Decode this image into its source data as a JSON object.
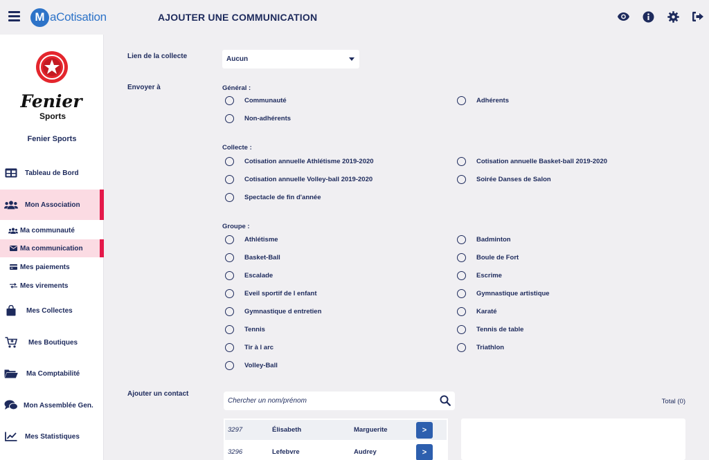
{
  "header": {
    "logo_letter": "M",
    "logo_text": "aCotisation",
    "page_title": "AJOUTER UNE COMMUNICATION",
    "icons": [
      "eye-icon",
      "info-icon",
      "gear-icon",
      "logout-icon"
    ]
  },
  "sidebar": {
    "club_name": "Fenier Sports",
    "club_logo_text": "Fenier",
    "club_logo_subtext": "Sports",
    "items": [
      {
        "label": "Tableau de Bord",
        "icon": "dashboard-icon"
      },
      {
        "label": "Mon Association",
        "icon": "users-icon",
        "active": true
      },
      {
        "label": "Ma communauté",
        "icon": "users-small-icon"
      },
      {
        "label": "Ma communication",
        "icon": "envelope-icon",
        "active": true
      },
      {
        "label": "Mes paiements",
        "icon": "card-icon"
      },
      {
        "label": "Mes virements",
        "icon": "transfer-icon"
      },
      {
        "label": "Mes Collectes",
        "icon": "bag-icon"
      },
      {
        "label": "Mes Boutiques",
        "icon": "cart-icon"
      },
      {
        "label": "Ma Comptabilité",
        "icon": "folder-icon"
      },
      {
        "label": "Mon Assemblée Gen.",
        "icon": "comments-icon"
      },
      {
        "label": "Mes Statistiques",
        "icon": "chart-icon"
      }
    ]
  },
  "form": {
    "collecte_label": "Lien de la collecte",
    "collecte_value": "Aucun",
    "envoyer_label": "Envoyer à",
    "general_title": "Général :",
    "general": [
      "Communauté",
      "Adhérents",
      "Non-adhérents"
    ],
    "collecte_title": "Collecte :",
    "collectes": [
      "Cotisation annuelle Athlétisme 2019-2020",
      "Cotisation annuelle Basket-ball 2019-2020",
      "Cotisation annuelle Volley-ball 2019-2020",
      "Soirée Danses de Salon",
      "Spectacle de fin d'année"
    ],
    "groupe_title": "Groupe :",
    "groupes": [
      "Athlétisme",
      "Badminton",
      "Basket-Ball",
      "Boule de Fort",
      "Escalade",
      "Escrime",
      "Eveil sportif de l enfant",
      "Gymnastique artistique",
      "Gymnastique d entretien",
      "Karaté",
      "Tennis",
      "Tennis de table",
      "Tir à l arc",
      "Triathlon",
      "Volley-Ball"
    ],
    "contact_label": "Ajouter un contact",
    "search_placeholder": "Chercher un nom/prénom",
    "total": "Total (0)"
  },
  "contacts": [
    {
      "id": "3297",
      "first": "Élisabeth",
      "last": "Marguerite",
      "btn": ">"
    },
    {
      "id": "3296",
      "first": "Lefebvre",
      "last": "Audrey",
      "btn": ">"
    }
  ],
  "colors": {
    "accent": "#e4194a",
    "brand": "#2d73c8",
    "text": "#1d2a5c",
    "active_bg": "#fbdbe3"
  }
}
